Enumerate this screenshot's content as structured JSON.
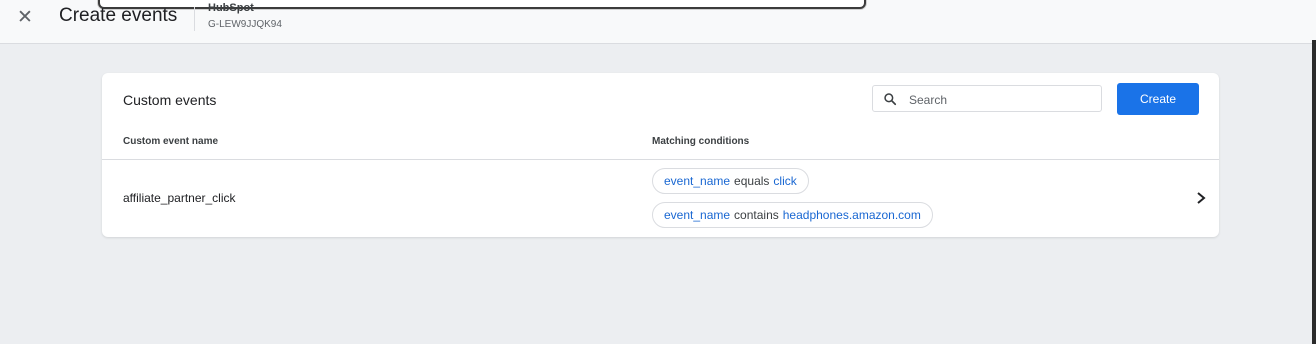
{
  "header": {
    "close_icon": "close-icon",
    "title": "Create events",
    "property_name": "HubSpot",
    "property_id": "G-LEW9JJQK94"
  },
  "card": {
    "title": "Custom events",
    "search": {
      "placeholder": "Search",
      "value": "",
      "icon": "search-icon"
    },
    "create_label": "Create",
    "columns": [
      "Custom event name",
      "Matching conditions"
    ],
    "rows": [
      {
        "name": "affiliate_partner_click",
        "conditions": [
          {
            "field": "event_name",
            "operator": "equals",
            "value": "click"
          },
          {
            "field": "event_name",
            "operator": "contains",
            "value": "headphones.amazon.com"
          }
        ]
      }
    ]
  },
  "colors": {
    "accent": "#1a73e8",
    "link": "#1967d2",
    "background": "#eceef1"
  }
}
